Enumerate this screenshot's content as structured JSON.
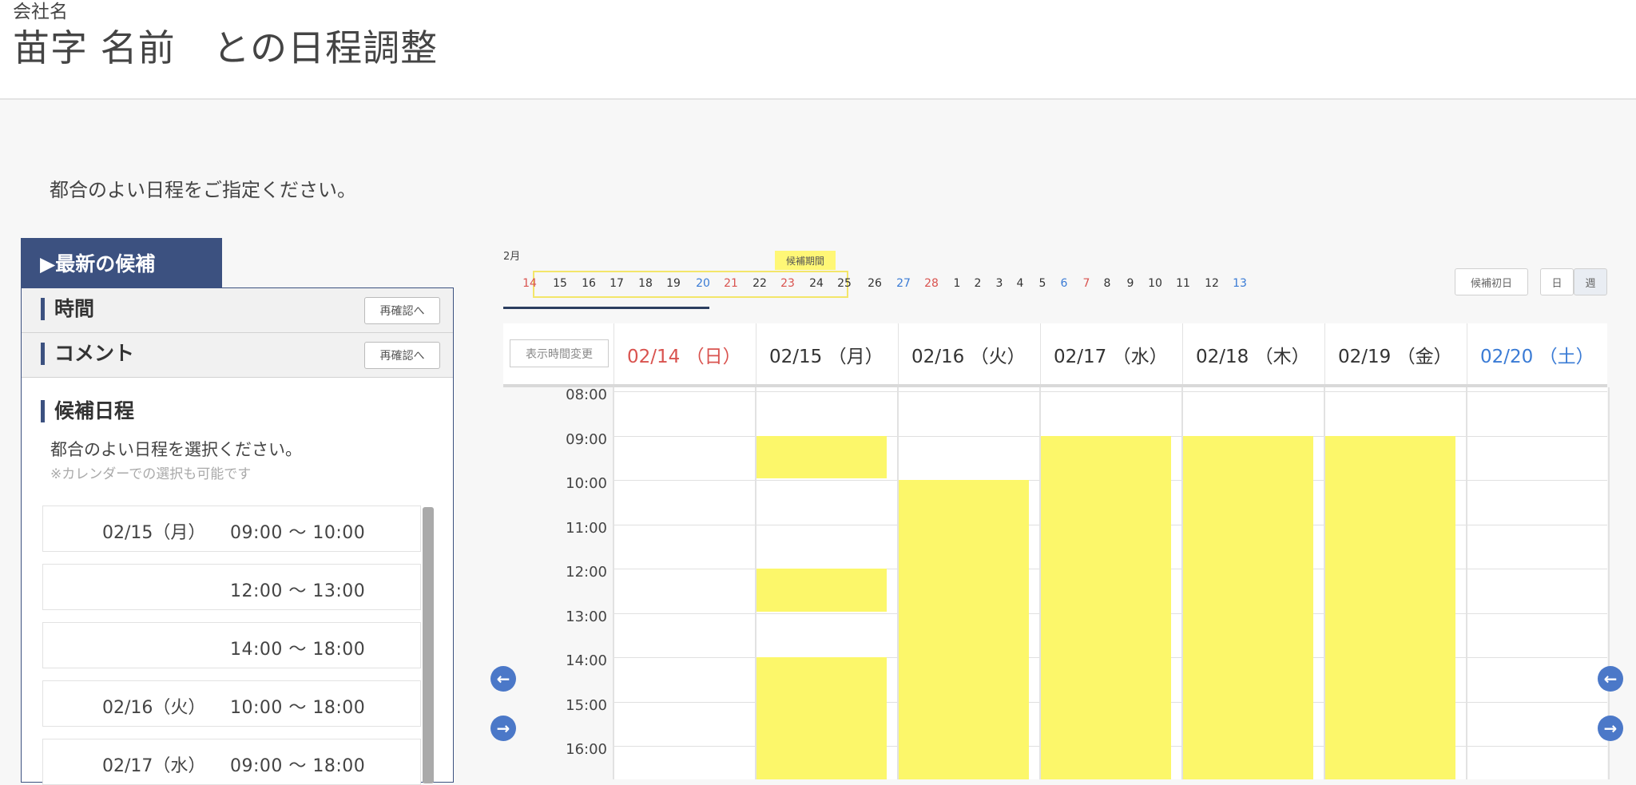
{
  "header": {
    "company": "会社名",
    "title": "苗字 名前　との日程調整"
  },
  "instruction": "都合のよい日程をご指定ください。",
  "left_panel": {
    "tab_label": "▶最新の候補",
    "time_label": "時間",
    "comment_label": "コメント",
    "recheck_label": "再確認へ",
    "candidates_title": "候補日程",
    "candidates_sub": "都合のよい日程を選択ください。",
    "candidates_note": "※カレンダーでの選択も可能です",
    "slots": [
      {
        "date": "02/15（月）",
        "time": "09:00 〜 10:00"
      },
      {
        "date": "",
        "time": "12:00 〜 13:00"
      },
      {
        "date": "",
        "time": "14:00 〜 18:00"
      },
      {
        "date": "02/16（火）",
        "time": "10:00 〜 18:00"
      },
      {
        "date": "02/17（水）",
        "time": "09:00 〜 18:00"
      }
    ]
  },
  "mini_calendar": {
    "month": "2月",
    "period_label": "候補期間",
    "days": [
      {
        "d": "14",
        "c": "#d9534f"
      },
      {
        "d": "15",
        "c": "#333"
      },
      {
        "d": "16",
        "c": "#333"
      },
      {
        "d": "17",
        "c": "#333"
      },
      {
        "d": "18",
        "c": "#333"
      },
      {
        "d": "19",
        "c": "#333"
      },
      {
        "d": "20",
        "c": "#3a7bd5"
      },
      {
        "d": "21",
        "c": "#d9534f"
      },
      {
        "d": "22",
        "c": "#333"
      },
      {
        "d": "23",
        "c": "#d9534f"
      },
      {
        "d": "24",
        "c": "#333"
      },
      {
        "d": "25",
        "c": "#333"
      },
      {
        "d": "26",
        "c": "#333"
      },
      {
        "d": "27",
        "c": "#3a7bd5"
      },
      {
        "d": "28",
        "c": "#d9534f"
      },
      {
        "d": "1",
        "c": "#333"
      },
      {
        "d": "2",
        "c": "#333"
      },
      {
        "d": "3",
        "c": "#333"
      },
      {
        "d": "4",
        "c": "#333"
      },
      {
        "d": "5",
        "c": "#333"
      },
      {
        "d": "6",
        "c": "#3a7bd5"
      },
      {
        "d": "7",
        "c": "#d9534f"
      },
      {
        "d": "8",
        "c": "#333"
      },
      {
        "d": "9",
        "c": "#333"
      },
      {
        "d": "10",
        "c": "#333"
      },
      {
        "d": "11",
        "c": "#333"
      },
      {
        "d": "12",
        "c": "#333"
      },
      {
        "d": "13",
        "c": "#3a7bd5"
      }
    ],
    "first_day_button": "候補初日",
    "day_button": "日",
    "week_button": "週"
  },
  "week_calendar": {
    "time_change_label": "表示時間変更",
    "days": [
      {
        "label": "02/14 （日）",
        "color": "#d9534f"
      },
      {
        "label": "02/15 （月）",
        "color": "#333"
      },
      {
        "label": "02/16 （火）",
        "color": "#333"
      },
      {
        "label": "02/17 （水）",
        "color": "#333"
      },
      {
        "label": "02/18 （木）",
        "color": "#333"
      },
      {
        "label": "02/19 （金）",
        "color": "#333"
      },
      {
        "label": "02/20 （土）",
        "color": "#3a7bd5"
      }
    ],
    "times": [
      "08:00",
      "09:00",
      "10:00",
      "11:00",
      "12:00",
      "13:00",
      "14:00",
      "15:00",
      "16:00"
    ],
    "availability": [
      {
        "day": 1,
        "start": 9,
        "end": 10
      },
      {
        "day": 1,
        "start": 12,
        "end": 13
      },
      {
        "day": 1,
        "start": 14,
        "end": 18
      },
      {
        "day": 2,
        "start": 10,
        "end": 18
      },
      {
        "day": 3,
        "start": 9,
        "end": 18
      },
      {
        "day": 4,
        "start": 9,
        "end": 18
      },
      {
        "day": 5,
        "start": 9,
        "end": 18
      }
    ],
    "block_color": "#fcf76a"
  },
  "nav": {
    "prev_icon": "arrow-left-icon",
    "next_icon": "arrow-right-icon"
  }
}
